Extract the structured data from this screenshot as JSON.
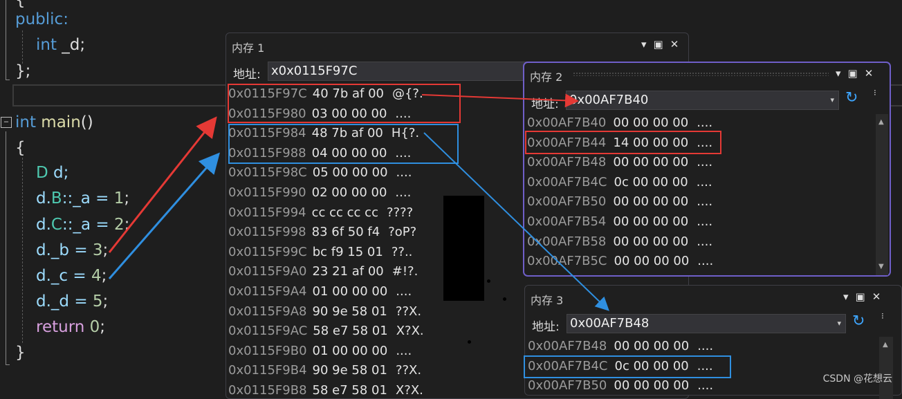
{
  "code": {
    "lines": {
      "brace_top": "{",
      "public": "public:",
      "int_kw": "int",
      "member_d": " _d;",
      "close_class": "};",
      "int_main_kw": "int",
      "main_fn": " main",
      "main_parens": "()",
      "open_brace": "{",
      "decl_type": "D",
      "decl_rest": " d;",
      "b_d": "d.",
      "b_cls": "B",
      "b_rest": "::_a = ",
      "b_val": "1",
      "b_end": ";",
      "c_d": "d.",
      "c_cls": "C",
      "c_rest": "::_a = ",
      "c_val": "2",
      "c_end": ";",
      "bb_pre": "d._b = ",
      "bb_val": "3",
      "bb_end": ";",
      "cc_pre": "d._c = ",
      "cc_val": "4",
      "cc_end": ";",
      "dd_pre": "d._d = ",
      "dd_val": "5",
      "dd_end": ";",
      "return_kw": "return",
      "return_val": " 0",
      "return_end": ";",
      "close_brace": "}"
    },
    "fold_glyph": "−"
  },
  "memory1": {
    "title": "内存 1",
    "address_label": "地址:",
    "address_value": "x0x0115F97C",
    "rows": [
      {
        "addr": "0x0115F97C",
        "hex": "40 7b af 00",
        "ascii": "@{?."
      },
      {
        "addr": "0x0115F980",
        "hex": "03 00 00 00",
        "ascii": "...."
      },
      {
        "addr": "0x0115F984",
        "hex": "48 7b af 00",
        "ascii": "H{?."
      },
      {
        "addr": "0x0115F988",
        "hex": "04 00 00 00",
        "ascii": "...."
      },
      {
        "addr": "0x0115F98C",
        "hex": "05 00 00 00",
        "ascii": "...."
      },
      {
        "addr": "0x0115F990",
        "hex": "02 00 00 00",
        "ascii": "...."
      },
      {
        "addr": "0x0115F994",
        "hex": "cc cc cc cc",
        "ascii": "????"
      },
      {
        "addr": "0x0115F998",
        "hex": "83 6f 50 f4",
        "ascii": "?oP?"
      },
      {
        "addr": "0x0115F99C",
        "hex": "bc f9 15 01",
        "ascii": "??.."
      },
      {
        "addr": "0x0115F9A0",
        "hex": "23 21 af 00",
        "ascii": "#!?."
      },
      {
        "addr": "0x0115F9A4",
        "hex": "01 00 00 00",
        "ascii": "...."
      },
      {
        "addr": "0x0115F9A8",
        "hex": "90 9e 58 01",
        "ascii": "??X."
      },
      {
        "addr": "0x0115F9AC",
        "hex": "58 e7 58 01",
        "ascii": "X?X."
      },
      {
        "addr": "0x0115F9B0",
        "hex": "01 00 00 00",
        "ascii": "...."
      },
      {
        "addr": "0x0115F9B4",
        "hex": "90 9e 58 01",
        "ascii": "??X."
      },
      {
        "addr": "0x0115F9B8",
        "hex": "58 e7 58 01",
        "ascii": "X?X."
      }
    ]
  },
  "memory2": {
    "title": "内存 2",
    "address_label": "地址:",
    "address_value": "0x00AF7B40",
    "rows": [
      {
        "addr": "0x00AF7B40",
        "hex": "00 00 00 00",
        "ascii": "...."
      },
      {
        "addr": "0x00AF7B44",
        "hex": "14 00 00 00",
        "ascii": "...."
      },
      {
        "addr": "0x00AF7B48",
        "hex": "00 00 00 00",
        "ascii": "...."
      },
      {
        "addr": "0x00AF7B4C",
        "hex": "0c 00 00 00",
        "ascii": "...."
      },
      {
        "addr": "0x00AF7B50",
        "hex": "00 00 00 00",
        "ascii": "...."
      },
      {
        "addr": "0x00AF7B54",
        "hex": "00 00 00 00",
        "ascii": "...."
      },
      {
        "addr": "0x00AF7B58",
        "hex": "00 00 00 00",
        "ascii": "...."
      },
      {
        "addr": "0x00AF7B5C",
        "hex": "00 00 00 00",
        "ascii": "...."
      }
    ]
  },
  "memory3": {
    "title": "内存 3",
    "address_label": "地址:",
    "address_value": "0x00AF7B48",
    "rows": [
      {
        "addr": "0x00AF7B48",
        "hex": "00 00 00 00",
        "ascii": "...."
      },
      {
        "addr": "0x00AF7B4C",
        "hex": "0c 00 00 00",
        "ascii": "...."
      },
      {
        "addr": "0x00AF7B50",
        "hex": "00 00 00 00",
        "ascii": "...."
      }
    ]
  },
  "window_controls": {
    "menu": "▾",
    "maximize": "▣",
    "close": "✕",
    "dropdown": "▾",
    "refresh": "↻",
    "overflow": "⁝"
  },
  "icons": {
    "refresh": "refresh-icon",
    "close": "close-icon",
    "maximize": "maximize-icon",
    "dropdown": "chevron-down-icon"
  },
  "colors": {
    "highlight_red": "#e53935",
    "highlight_blue": "#2f8fe0",
    "window2_border": "#6f5fc9"
  },
  "watermark": "CSDN @花想云"
}
